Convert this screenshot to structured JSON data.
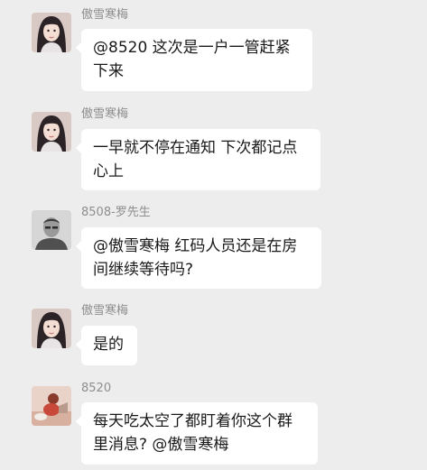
{
  "messages": [
    {
      "sender": "傲雪寒梅",
      "avatar": "girl-avatar-icon",
      "lines": [
        "@8520 这次是一户一管赶紧",
        "下来"
      ]
    },
    {
      "sender": "傲雪寒梅",
      "avatar": "girl-avatar-icon",
      "lines": [
        "一早就不停在通知 下次都记点",
        "心上"
      ]
    },
    {
      "sender": "8508-罗先生",
      "avatar": "man-avatar-icon",
      "lines": [
        "@傲雪寒梅 红码人员还是在房",
        "间继续等待吗?"
      ]
    },
    {
      "sender": "傲雪寒梅",
      "avatar": "girl-avatar-icon",
      "lines": [
        "是的"
      ]
    },
    {
      "sender": "8520",
      "avatar": "photo-avatar-icon",
      "lines": [
        "每天吃太空了都盯着你这个群",
        "里消息? @傲雪寒梅"
      ]
    }
  ],
  "colors": {
    "background": "#ededed",
    "bubble": "#ffffff",
    "sender_text": "#8e8e8e",
    "message_text": "#191919"
  }
}
